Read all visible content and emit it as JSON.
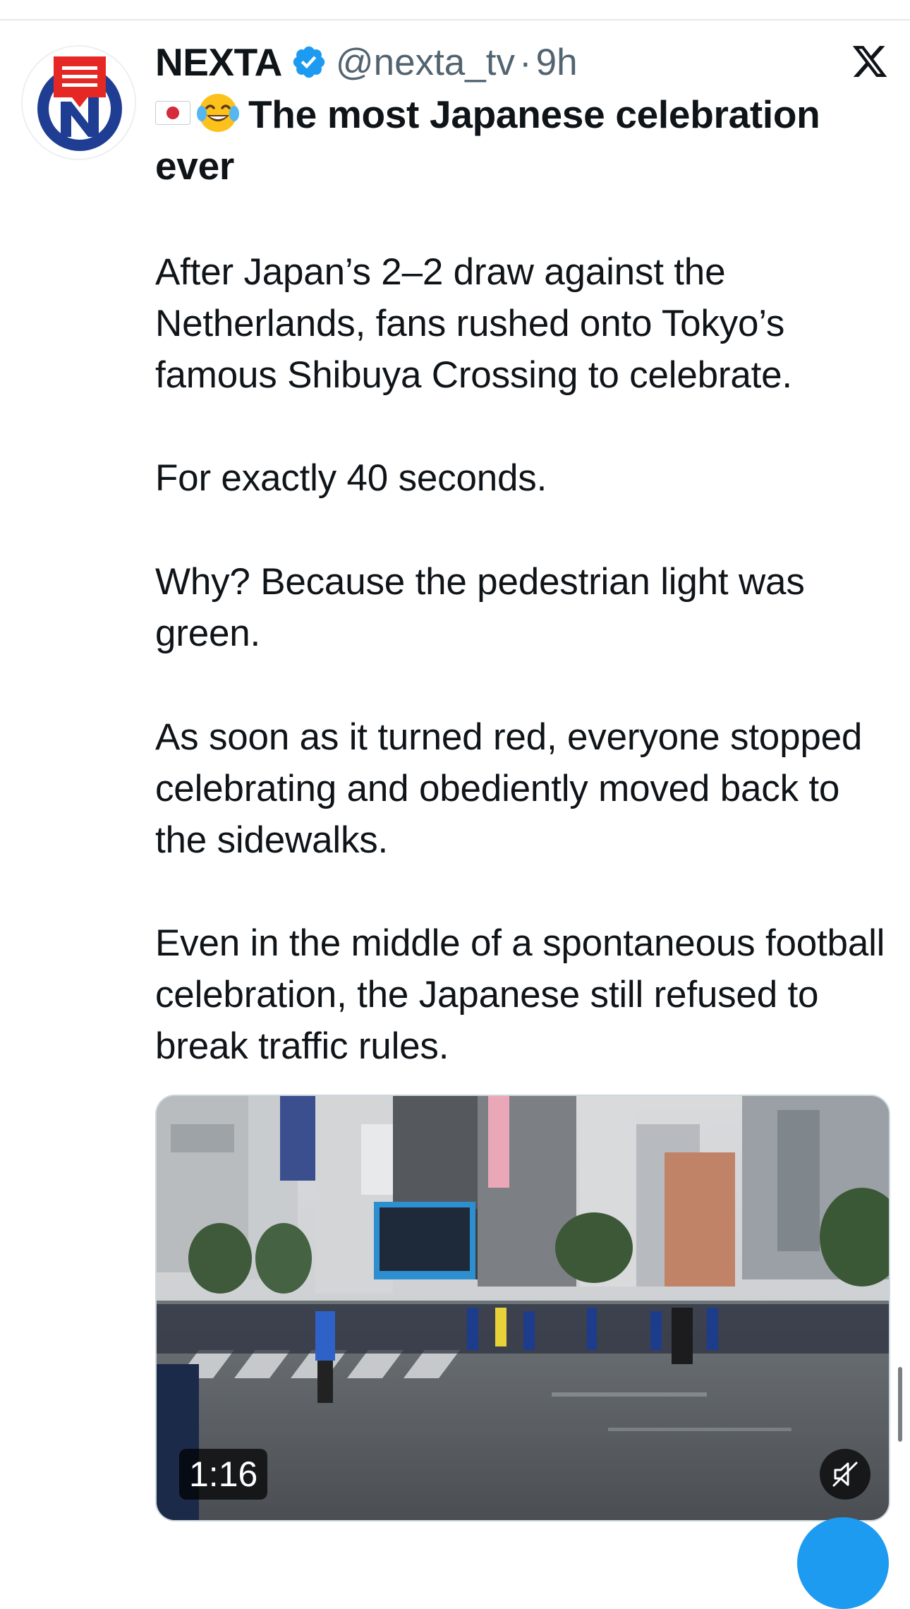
{
  "tweet": {
    "display_name": "NEXTA",
    "handle": "@nexta_tv",
    "separator": "·",
    "time": "9h",
    "title": "The most Japanese celebration ever",
    "paragraphs": [
      "After Japan’s 2–2 draw against the Netherlands, fans rushed onto Tokyo’s famous Shibuya Crossing to celebrate.",
      "For exactly 40 seconds.",
      "Why? Because the pedestrian light was green.",
      "As soon as it turned red, everyone stopped celebrating and obediently moved back to the sidewalks.",
      "Even in the middle of a spontaneous football celebration, the Japanese still refused to break traffic rules."
    ]
  },
  "media": {
    "duration": "1:16",
    "muted": true
  },
  "icons": {
    "verified": "verified-badge-icon",
    "platform": "x-logo-icon",
    "flag": "japan-flag-icon",
    "emoji": "tears-of-joy-icon",
    "mute": "muted-speaker-icon"
  },
  "colors": {
    "accent": "#1d9bf0",
    "secondary_text": "#536471",
    "avatar_blue": "#1f3e93",
    "avatar_red": "#e52823"
  }
}
